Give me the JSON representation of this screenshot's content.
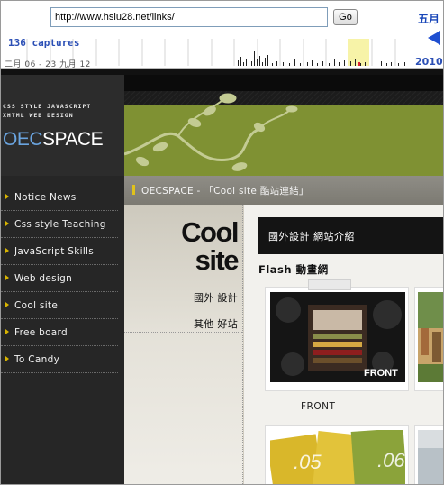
{
  "wayback": {
    "url": "http://www.hsiu28.net/links/",
    "go_label": "Go",
    "month": "五月",
    "captures": "136 captures",
    "date_range": "二月 06 - 23 九月 12",
    "year": "2010"
  },
  "sidebar": {
    "tagline_1": "CSS STYLE JAVASCRIPT",
    "tagline_2": "XHTML WEB DESIGN",
    "logo_a": "OEC",
    "logo_b": "SPACE",
    "items": [
      {
        "label": "Notice News"
      },
      {
        "label": "Css style Teaching"
      },
      {
        "label": "JavaScript Skills"
      },
      {
        "label": "Web design"
      },
      {
        "label": "Cool site"
      },
      {
        "label": "Free board"
      },
      {
        "label": "To Candy"
      }
    ]
  },
  "breadcrumb": {
    "text": "OECSPACE - 「Cool site 酷站連結」"
  },
  "subnav": {
    "title_line1": "Cool",
    "title_line2": "site",
    "links": [
      {
        "label": "國外 設計"
      },
      {
        "label": "其他 好站"
      }
    ]
  },
  "main": {
    "bar_title": "國外設計 網站介紹",
    "section_title": "Flash 動畫網",
    "cards": [
      {
        "caption": "FRONT",
        "thumb_text": "FRONT"
      },
      {
        "thumb_text": ".05"
      },
      {
        "thumb_text": ".06"
      }
    ]
  },
  "colors": {
    "accent_yellow": "#d8b400",
    "banner_green": "#7f9133",
    "link_blue": "#2b4fb5"
  }
}
